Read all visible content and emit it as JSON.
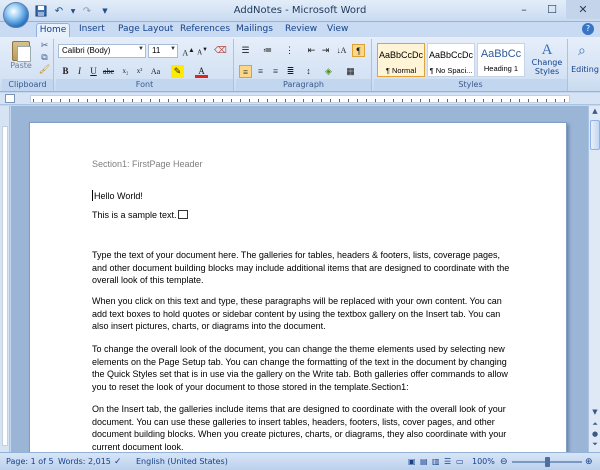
{
  "window": {
    "title": "AddNotes - Microsoft Word"
  },
  "qat_icons": [
    "save-icon",
    "undo-icon",
    "redo-icon",
    "customize-icon"
  ],
  "tabs": [
    {
      "label": "Home"
    },
    {
      "label": "Insert"
    },
    {
      "label": "Page Layout"
    },
    {
      "label": "References"
    },
    {
      "label": "Mailings"
    },
    {
      "label": "Review"
    },
    {
      "label": "View"
    }
  ],
  "ribbon": {
    "clipboard": {
      "paste_label": "Paste",
      "group_label": "Clipboard"
    },
    "font": {
      "font_name": "Calibri (Body)",
      "font_size": "11",
      "group_label": "Font"
    },
    "paragraph": {
      "group_label": "Paragraph"
    },
    "styles": {
      "items": [
        {
          "preview": "AaBbCcDc",
          "name": "¶ Normal"
        },
        {
          "preview": "AaBbCcDc",
          "name": "¶ No Spaci..."
        },
        {
          "preview": "AaBbCc",
          "name": "Heading 1"
        }
      ],
      "change_styles_label": "Change Styles",
      "group_label": "Styles"
    },
    "editing": {
      "label": "Editing"
    }
  },
  "document": {
    "header": "Section1: FirstPage Header",
    "lines": [
      "Hello World!",
      "This is a sample text."
    ],
    "paragraphs": [
      "Type the text of your document here. The galleries for tables, headers & footers, lists, coverage pages, and other document building blocks may include additional items that are designed to coordinate with the overall look of this template.",
      "When you click on this text and type, these paragraphs will be replaced with your own content. You can add text boxes to hold quotes or sidebar content by using the textbox gallery on the Insert tab. You can also insert pictures, charts, or diagrams into the document.",
      "To change the overall look of the document, you can change the theme elements used by selecting new elements on the Page Setup tab. You can change the formatting of the text in the document by changing the Quick Styles set that is in use via the gallery on the Write tab. Both galleries offer commands to allow you to reset the look of your document to those stored in the template.Section1:",
      "On the Insert tab, the galleries include items that are designed to coordinate with the overall look of your document. You can use these galleries to insert tables, headers, footers, lists, cover pages, and other document building blocks. When you create pictures, charts, or diagrams, they also coordinate with your current document look."
    ]
  },
  "status": {
    "page": "Page: 1 of 5",
    "words": "Words: 2,015",
    "language": "English (United States)",
    "zoom": "100%"
  }
}
